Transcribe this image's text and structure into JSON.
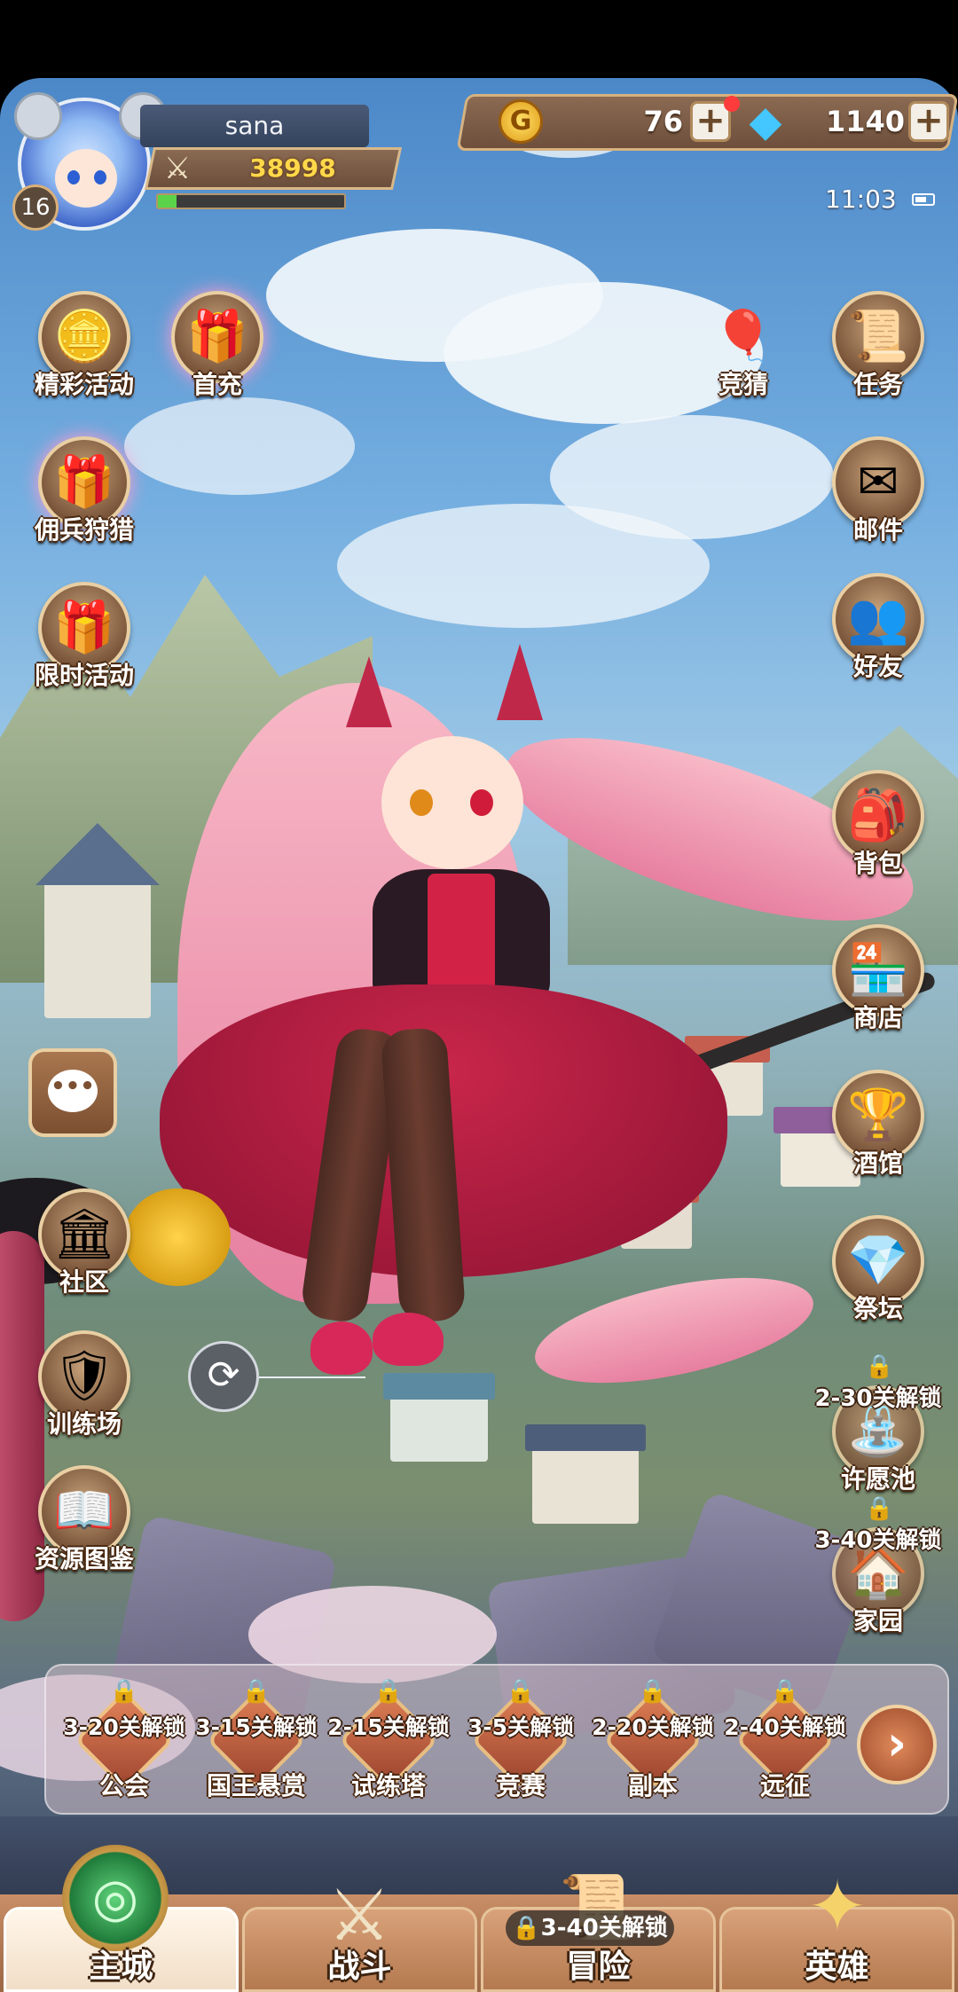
{
  "player": {
    "name": "sana",
    "level": "16",
    "power": "38998",
    "exp_fraction": 0.1
  },
  "resources": {
    "gold": "76",
    "gems": "1140"
  },
  "status": {
    "time": "11:03"
  },
  "left_menu": [
    {
      "label": "精彩活动",
      "icon": "gift-coins-icon"
    },
    {
      "label": "首充",
      "icon": "gift-box-icon"
    },
    {
      "label": "佣兵狩猎",
      "icon": "gift-box-pink-icon"
    },
    {
      "label": "限时活动",
      "icon": "gift-box-green-icon"
    },
    {
      "label": "社区",
      "icon": "community-building-icon"
    },
    {
      "label": "训练场",
      "icon": "training-ground-icon"
    },
    {
      "label": "资源图鉴",
      "icon": "resource-book-icon"
    }
  ],
  "right_menu": [
    {
      "label": "竞猜",
      "icon": "balloons-icon"
    },
    {
      "label": "任务",
      "icon": "scroll-icon"
    },
    {
      "label": "邮件",
      "icon": "mail-icon"
    },
    {
      "label": "好友",
      "icon": "friends-icon"
    },
    {
      "label": "背包",
      "icon": "backpack-icon"
    },
    {
      "label": "商店",
      "icon": "shop-icon"
    },
    {
      "label": "酒馆",
      "icon": "tavern-icon"
    },
    {
      "label": "祭坛",
      "icon": "altar-icon"
    },
    {
      "label": "许愿池",
      "icon": "wishing-well-icon",
      "lock": "2-30关解锁"
    },
    {
      "label": "家园",
      "icon": "home-icon",
      "lock": "3-40关解锁"
    }
  ],
  "strip": [
    {
      "label": "公会",
      "lock": "3-20关解锁"
    },
    {
      "label": "国王悬赏",
      "lock": "3-15关解锁"
    },
    {
      "label": "试练塔",
      "lock": "2-15关解锁"
    },
    {
      "label": "竞赛",
      "lock": "3-5关解锁"
    },
    {
      "label": "副本",
      "lock": "2-20关解锁"
    },
    {
      "label": "远征",
      "lock": "2-40关解锁"
    }
  ],
  "tabs": [
    {
      "label": "主城",
      "active": true
    },
    {
      "label": "战斗"
    },
    {
      "label": "冒险",
      "lock": "3-40关解锁"
    },
    {
      "label": "英雄"
    }
  ],
  "colors": {
    "accent": "#d7b27f",
    "exp": "#5ad34a",
    "power": "#ffd84a"
  }
}
